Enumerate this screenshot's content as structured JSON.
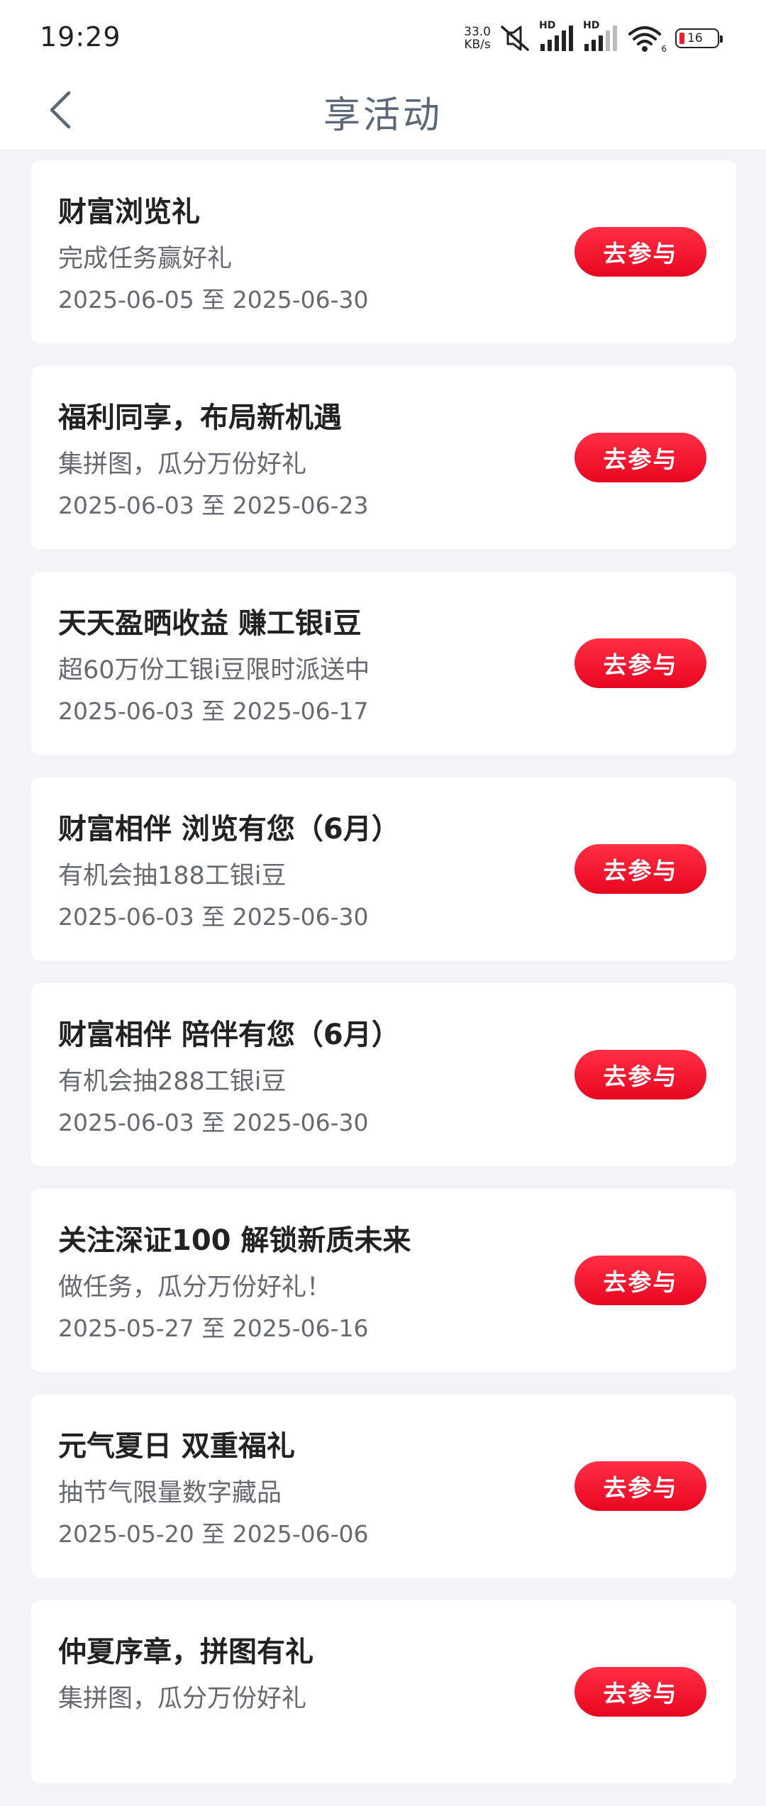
{
  "status_bar": {
    "time": "19:29",
    "net_speed_value": "33.0",
    "net_speed_unit": "KB/s",
    "signal1_label": "HD",
    "signal2_label": "HD",
    "wifi_label": "6",
    "battery_level": "16",
    "icons": [
      "mute-icon",
      "signal-icon",
      "signal-icon",
      "wifi-icon",
      "battery-icon"
    ]
  },
  "header": {
    "title": "享活动",
    "back_icon": "chevron-left-icon"
  },
  "activities": [
    {
      "title": "财富浏览礼",
      "subtitle": "完成任务赢好礼",
      "date": "2025-06-05 至 2025-06-30",
      "button": "去参与"
    },
    {
      "title": "福利同享，布局新机遇",
      "subtitle": "集拼图，瓜分万份好礼",
      "date": "2025-06-03 至 2025-06-23",
      "button": "去参与"
    },
    {
      "title": "天天盈晒收益 赚工银i豆",
      "subtitle": "超60万份工银i豆限时派送中",
      "date": "2025-06-03 至 2025-06-17",
      "button": "去参与"
    },
    {
      "title": "财富相伴 浏览有您（6月）",
      "subtitle": "有机会抽188工银i豆",
      "date": "2025-06-03 至 2025-06-30",
      "button": "去参与"
    },
    {
      "title": "财富相伴 陪伴有您（6月）",
      "subtitle": "有机会抽288工银i豆",
      "date": "2025-06-03 至 2025-06-30",
      "button": "去参与"
    },
    {
      "title": "关注深证100 解锁新质未来",
      "subtitle": "做任务，瓜分万份好礼！",
      "date": "2025-05-27 至 2025-06-16",
      "button": "去参与"
    },
    {
      "title": "元气夏日 双重福礼",
      "subtitle": "抽节气限量数字藏品",
      "date": "2025-05-20 至 2025-06-06",
      "button": "去参与"
    },
    {
      "title": "仲夏序章，拼图有礼",
      "subtitle": "集拼图，瓜分万份好礼",
      "date": "",
      "button": "去参与"
    }
  ],
  "colors": {
    "accent": "#e8061f",
    "background": "#f3f4f7",
    "title_color": "#5b6878"
  }
}
